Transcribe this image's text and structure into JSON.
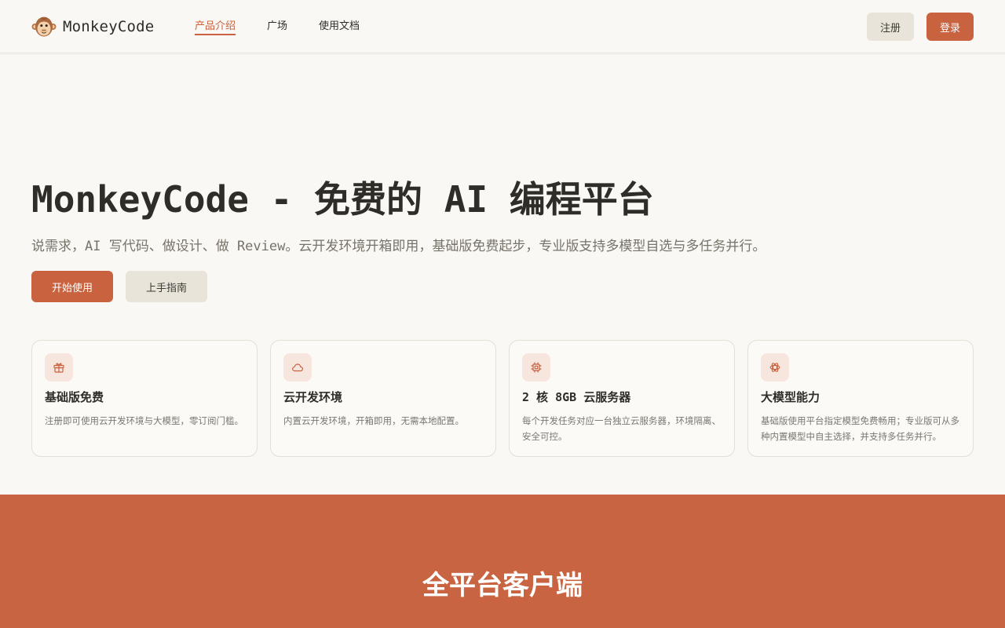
{
  "brand": {
    "name": "MonkeyCode",
    "logo_icon": "monkey-face-icon"
  },
  "nav": {
    "items": [
      {
        "label": "产品介绍",
        "active": true
      },
      {
        "label": "广场",
        "active": false
      },
      {
        "label": "使用文档",
        "active": false
      }
    ]
  },
  "auth": {
    "register_label": "注册",
    "login_label": "登录"
  },
  "hero": {
    "title": "MonkeyCode - 免费的 AI 编程平台",
    "subtitle": "说需求，AI 写代码、做设计、做 Review。云开发环境开箱即用，基础版免费起步，专业版支持多模型自选与多任务并行。",
    "start_label": "开始使用",
    "guide_label": "上手指南"
  },
  "features": [
    {
      "icon": "gift-icon",
      "title": "基础版免费",
      "desc": "注册即可使用云开发环境与大模型，零订阅门槛。"
    },
    {
      "icon": "cloud-icon",
      "title": "云开发环境",
      "desc": "内置云开发环境，开箱即用，无需本地配置。"
    },
    {
      "icon": "cpu-icon",
      "title": "2 核 8GB 云服务器",
      "desc": "每个开发任务对应一台独立云服务器，环境隔离、安全可控。"
    },
    {
      "icon": "ai-model-icon",
      "title": "大模型能力",
      "desc": "基础版使用平台指定模型免费畅用；专业版可从多种内置模型中自主选择，并支持多任务并行。"
    }
  ],
  "platform_section": {
    "title": "全平台客户端"
  },
  "colors": {
    "accent": "#c8623f",
    "background": "#faf8f4",
    "icon_tile": "#f6e6de",
    "secondary_button": "#e8e4da",
    "section_band": "#c96442"
  }
}
